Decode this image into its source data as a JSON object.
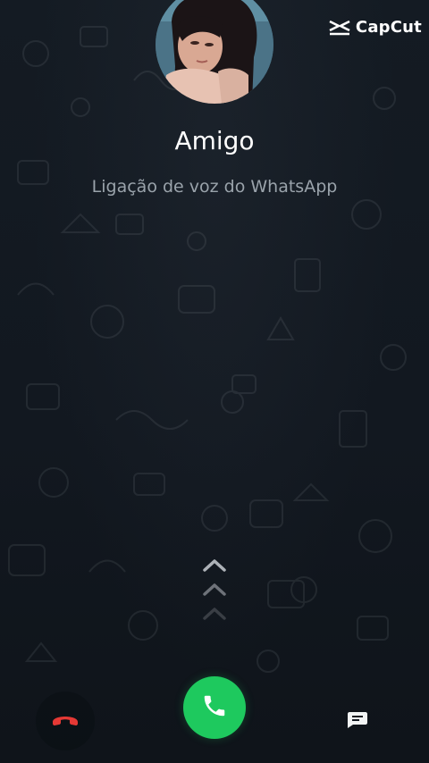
{
  "watermark": {
    "text": "CapCut",
    "icon": "capcut-logo-icon"
  },
  "caller": {
    "name": "Amigo",
    "call_type": "Ligação de voz do WhatsApp",
    "avatar": "contact-photo"
  },
  "actions": {
    "decline_icon": "phone-hangup-icon",
    "accept_icon": "phone-icon",
    "message_icon": "message-icon",
    "swipe_icon": "chevrons-up-icon"
  },
  "colors": {
    "background": "#121820",
    "accept": "#1ec95e",
    "decline": "#e53935",
    "secondary_text": "#9aa3ab"
  }
}
